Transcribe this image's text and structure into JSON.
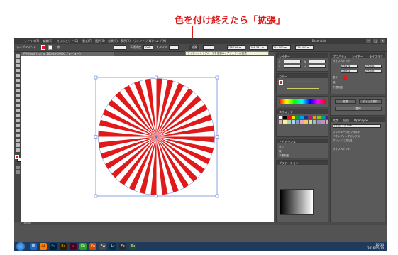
{
  "annotation": {
    "text": "色を付け終えたら「拡張」"
  },
  "app": {
    "menu": [
      "ファイル(F)",
      "編集(E)",
      "オブジェクト(O)",
      "書式(T)",
      "選択(S)",
      "効果(C)",
      "表示(V)",
      "ウィンドウ(W)",
      "ヘルプ(H)"
    ],
    "window_controls": [
      "–",
      "□",
      "×"
    ],
    "workspace_label": "Essentials"
  },
  "controlbar": {
    "object_label": "ライブペイント",
    "stroke_label": "線",
    "opacity_label": "不透明度",
    "opacity_value": "100%",
    "style_label": "スタイル",
    "expand_label": "拡張",
    "x_value": "228.199 m",
    "y_value": "188.331 m",
    "w_value": "225.000 m",
    "h_value": "225.000 m"
  },
  "tooltip": "ライブペイントグループを個別のオブジェクトに拡張",
  "document": {
    "tab": "円(Glyph)*.ai @ 100% (CMYK/プレビュー)"
  },
  "artwork": {
    "type": "sunburst",
    "rays": 32,
    "ray_color": "#e01a1a",
    "bg_color": "#ffffff"
  },
  "status": {
    "zoom": "100%"
  },
  "panels": {
    "properties": {
      "title": "プロパティ",
      "tabs": [
        "プロパティ",
        "レイヤー",
        "ライブラリ"
      ],
      "section": "ライブペイント"
    },
    "transform": {
      "x_label": "X",
      "y_label": "Y",
      "w_label": "W",
      "h_label": "H",
      "x": "228.199",
      "y": "188.331",
      "w": "225.000",
      "h": "225.000"
    },
    "color": {
      "title": "カラー",
      "tabs": [
        "カラー",
        "カラーガイド"
      ],
      "fill_label": "塗り",
      "stroke_label": "線"
    },
    "appearance": {
      "title": "アピアランス",
      "fill": "塗り",
      "stroke": "線",
      "opacity": "不透明度"
    },
    "swatches": {
      "title": "スウォッチ"
    },
    "gradient": {
      "title": "グラデーション"
    },
    "character": {
      "title": "文字",
      "tabs": [
        "文字",
        "段落",
        "OpenType"
      ],
      "font": "小塚ゴシック Pr6N",
      "checkbox_a": "プリンターのデフォルト",
      "checkbox_b": "バウンディングボックス",
      "checkbox_c": "グリッドに揃える"
    },
    "align": {
      "title": "整列",
      "btn_expand": "拡張",
      "btn_edit": "クイック操作"
    }
  },
  "taskbar": {
    "apps": [
      "IE",
      "Ai",
      "Ps",
      "Br",
      "Id",
      "Ch",
      "Fx",
      "Fw",
      "Lr",
      "Fe",
      "Ex"
    ],
    "time": "20:14",
    "date": "2016/05/10"
  }
}
